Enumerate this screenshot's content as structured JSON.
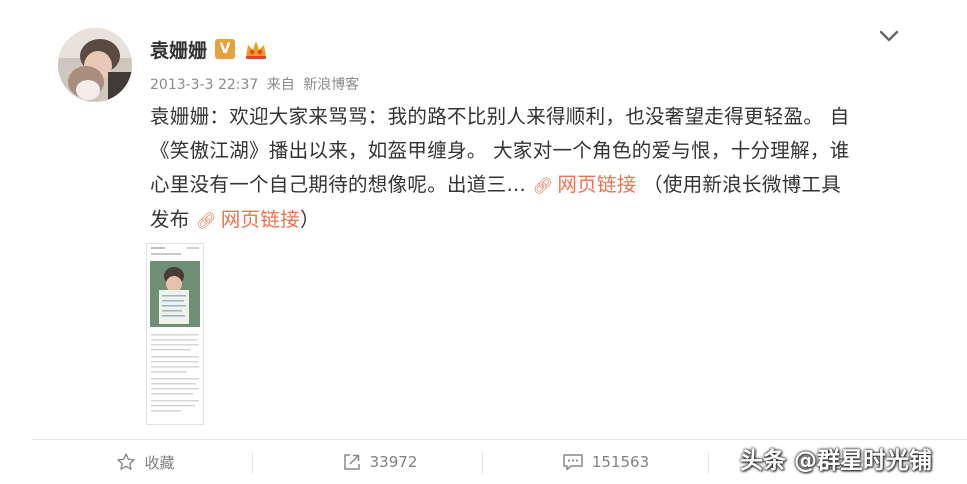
{
  "post": {
    "username": "袁姗姗",
    "verified_badge": "V",
    "member_icon": "vip-crown-icon",
    "timestamp": "2013-3-3 22:37",
    "source_prefix": "来自",
    "source": "新浪博客",
    "text_line_1": "袁姗姗：欢迎大家来骂骂：我的路不比别人来得顺利，也没奢望走得更轻盈。 自",
    "text_line_2": "《笑傲江湖》播出以来，如盔甲缠身。 大家对一个角色的爱与恨，十分理解，谁",
    "text_line_3_prefix": "心里没有一个自己期待的想像呢。出道三… ",
    "link_1": "网页链接",
    "text_line_3_suffix": " （使用新浪长微博工具",
    "text_line_4_prefix": "发布 ",
    "link_2": "网页链接",
    "text_line_4_suffix": "）",
    "link_color": "#eb7350",
    "badge_color": "#e6a23c"
  },
  "actions": {
    "favorite_label": "收藏",
    "repost_count": "33972",
    "comment_count": "151563"
  },
  "watermark": "头条 @群星时光铺"
}
